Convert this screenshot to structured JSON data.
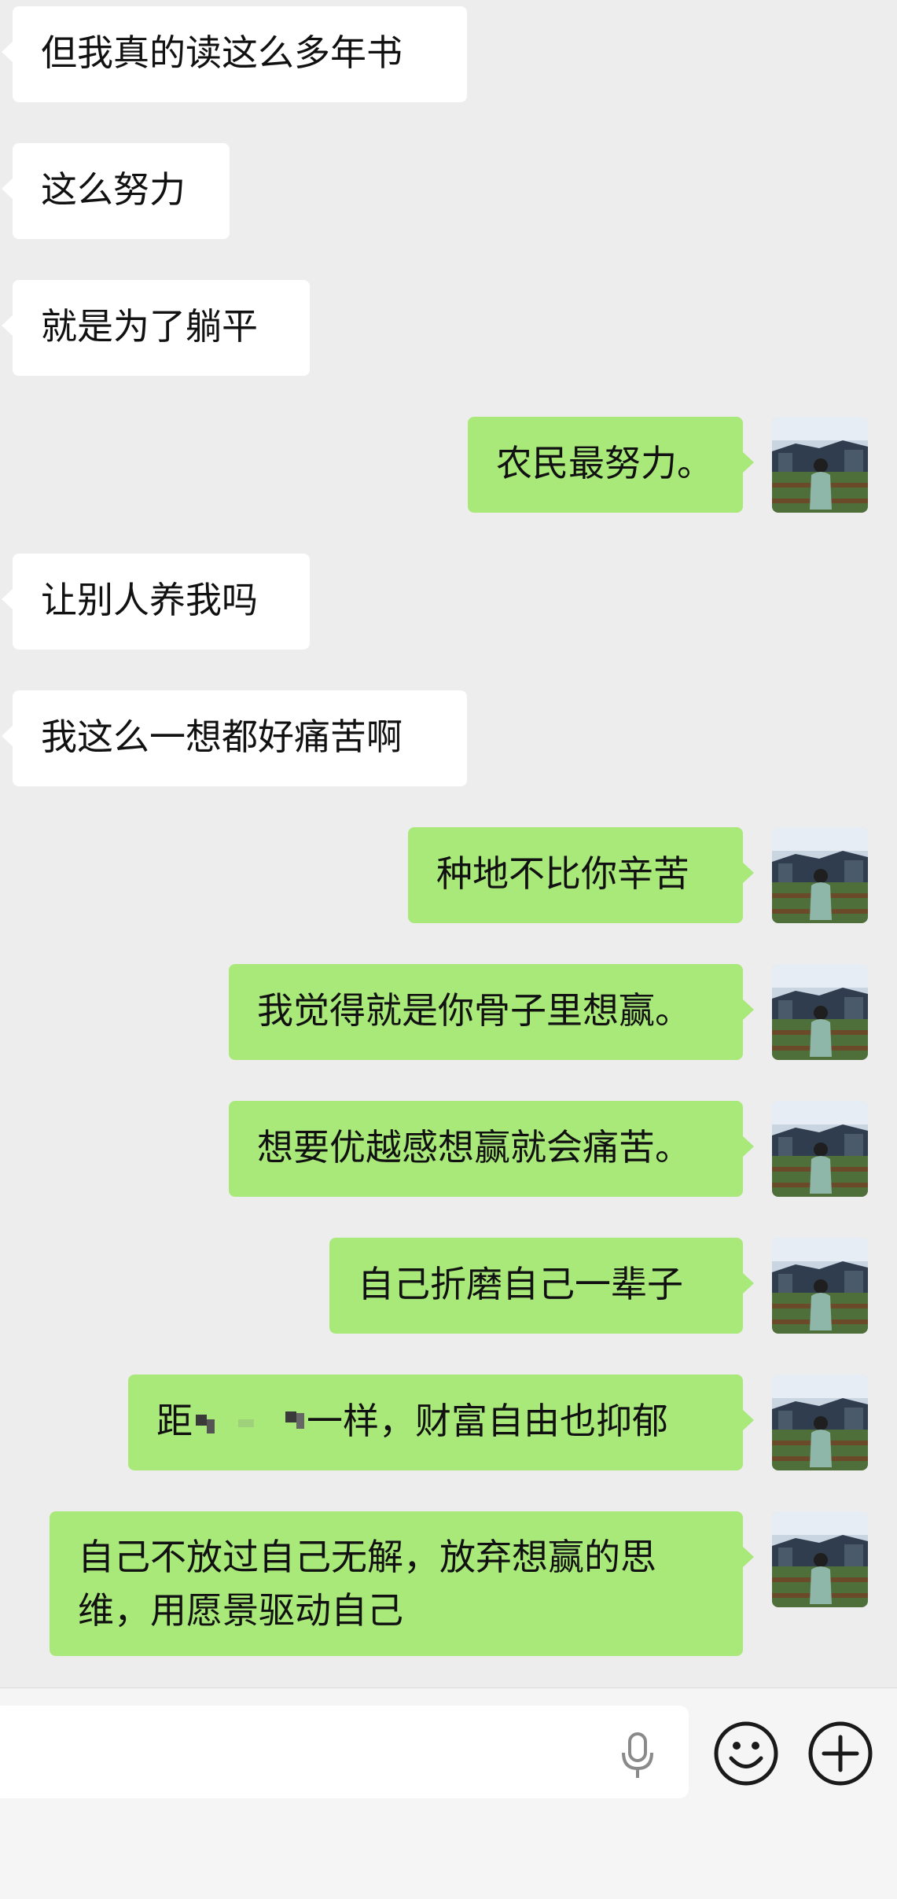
{
  "messages": [
    {
      "side": "left",
      "text": "但我真的读这么多年书"
    },
    {
      "side": "left",
      "text": "这么努力"
    },
    {
      "side": "left",
      "text": "就是为了躺平"
    },
    {
      "side": "right",
      "text": "农民最努力。"
    },
    {
      "side": "left",
      "text": "让别人养我吗"
    },
    {
      "side": "left",
      "text": "我这么一想都好痛苦啊"
    },
    {
      "side": "right",
      "text": "种地不比你辛苦"
    },
    {
      "side": "right",
      "text": "我觉得就是你骨子里想赢。"
    },
    {
      "side": "right",
      "text": "想要优越感想赢就会痛苦。"
    },
    {
      "side": "right",
      "text": "自己折磨自己一辈子"
    },
    {
      "side": "right",
      "text_before": "距",
      "text_after": "一样，财富自由也抑郁",
      "redacted": true
    },
    {
      "side": "right",
      "text": "自己不放过自己无解，放弃想赢的思维，用愿景驱动自己"
    }
  ],
  "input": {
    "value": "",
    "placeholder": ""
  },
  "icons": {
    "voice": "microphone-icon",
    "emoji": "emoji-icon",
    "more": "plus-icon"
  },
  "colors": {
    "background": "#ededed",
    "sent_bubble": "#a9e97a",
    "received_bubble": "#ffffff",
    "input_bar": "#f5f5f5"
  }
}
